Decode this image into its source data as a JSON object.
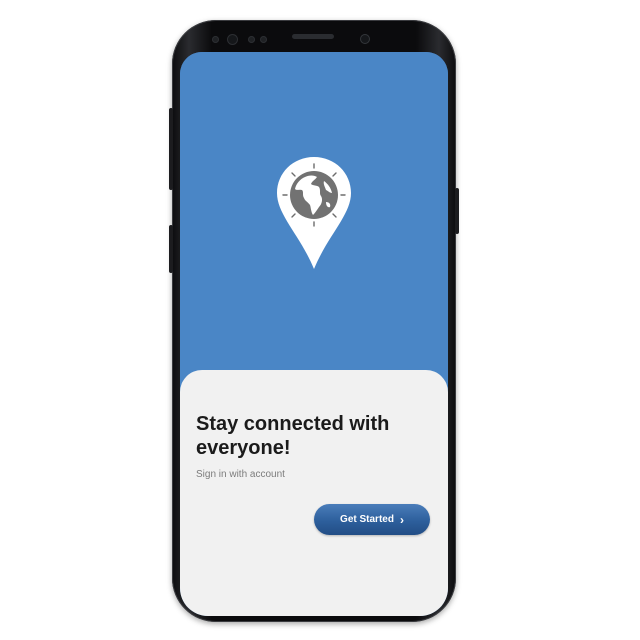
{
  "onboarding": {
    "headline": "Stay connected with everyone!",
    "subtitle": "Sign in with account",
    "cta_label": "Get Started",
    "cta_icon": "chevron-right-icon",
    "hero_icon": "globe-location-pin-icon"
  },
  "colors": {
    "hero_background": "#4a86c6",
    "sheet_background": "#f1f1f1",
    "button": "#2d5f9c",
    "headline_text": "#1b1b1b",
    "subtitle_text": "#7c7c7c"
  }
}
